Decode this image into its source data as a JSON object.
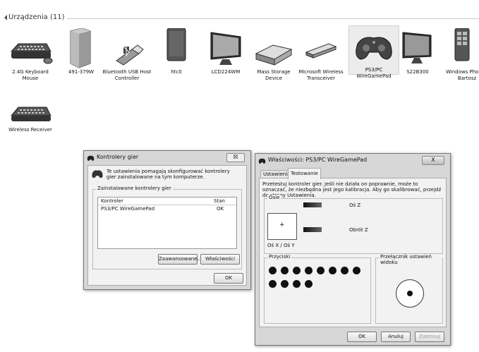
{
  "header": {
    "title": "Urządzenia (11)"
  },
  "devices": [
    {
      "label": "2.4G Keyboard Mouse",
      "icon": "keyboard-mouse-icon"
    },
    {
      "label": "491-379W",
      "icon": "pc-tower-icon"
    },
    {
      "label": "Bluetooth USB Host Controller",
      "icon": "bluetooth-usb-icon"
    },
    {
      "label": "htc0",
      "icon": "phone-icon"
    },
    {
      "label": "LCD224WM",
      "icon": "monitor-icon"
    },
    {
      "label": "Mass Storage Device",
      "icon": "hard-drive-icon"
    },
    {
      "label": "Microsoft Wireless Transceiver",
      "icon": "usb-dongle-icon"
    },
    {
      "label": "PS3/PC WireGamePad",
      "icon": "gamepad-icon"
    },
    {
      "label": "S22B300",
      "icon": "monitor-icon"
    },
    {
      "label": "Windows Phone - Bartosz",
      "icon": "windows-phone-icon"
    },
    {
      "label": "Wireless Receiver",
      "icon": "keyboard-icon"
    }
  ],
  "controllers_dialog": {
    "title": "Kontrolery gier",
    "close": "☒",
    "intro": "Te ustawienia pomagają skonfigurować kontrolery gier zainstalowane na tym komputerze.",
    "group_label": "Zainstalowane kontrolery gier",
    "col_controller": "Kontroler",
    "col_status": "Stan",
    "rows": [
      {
        "name": "PS3/PC WireGamePad",
        "status": "OK"
      }
    ],
    "btn_advanced": "Zaawansowane...",
    "btn_properties": "Właściwości",
    "btn_ok": "OK"
  },
  "props_dialog": {
    "title": "Właściwości: PS3/PC WireGamePad",
    "close": "X",
    "tab_settings": "Ustawienia",
    "tab_test": "Testowanie",
    "desc": "Przetestuj kontroler gier. Jeśli nie działa on poprawnie, może to oznaczać, że niezbędna jest jego kalibracja. Aby go skalibrować, przejdź do strony Ustawienia.",
    "axes_label": "Osie",
    "axis_z": "Oś Z",
    "rot_z": "Obrót Z",
    "xy_label": "Oś X / Oś Y",
    "buttons_label": "Przyciski",
    "pov_label": "Przełącznik ustawień widoku",
    "btn_ok": "OK",
    "btn_cancel": "Anuluj",
    "btn_apply": "Zastosuj",
    "button_count_row1": 8,
    "button_count_row2": 4
  }
}
